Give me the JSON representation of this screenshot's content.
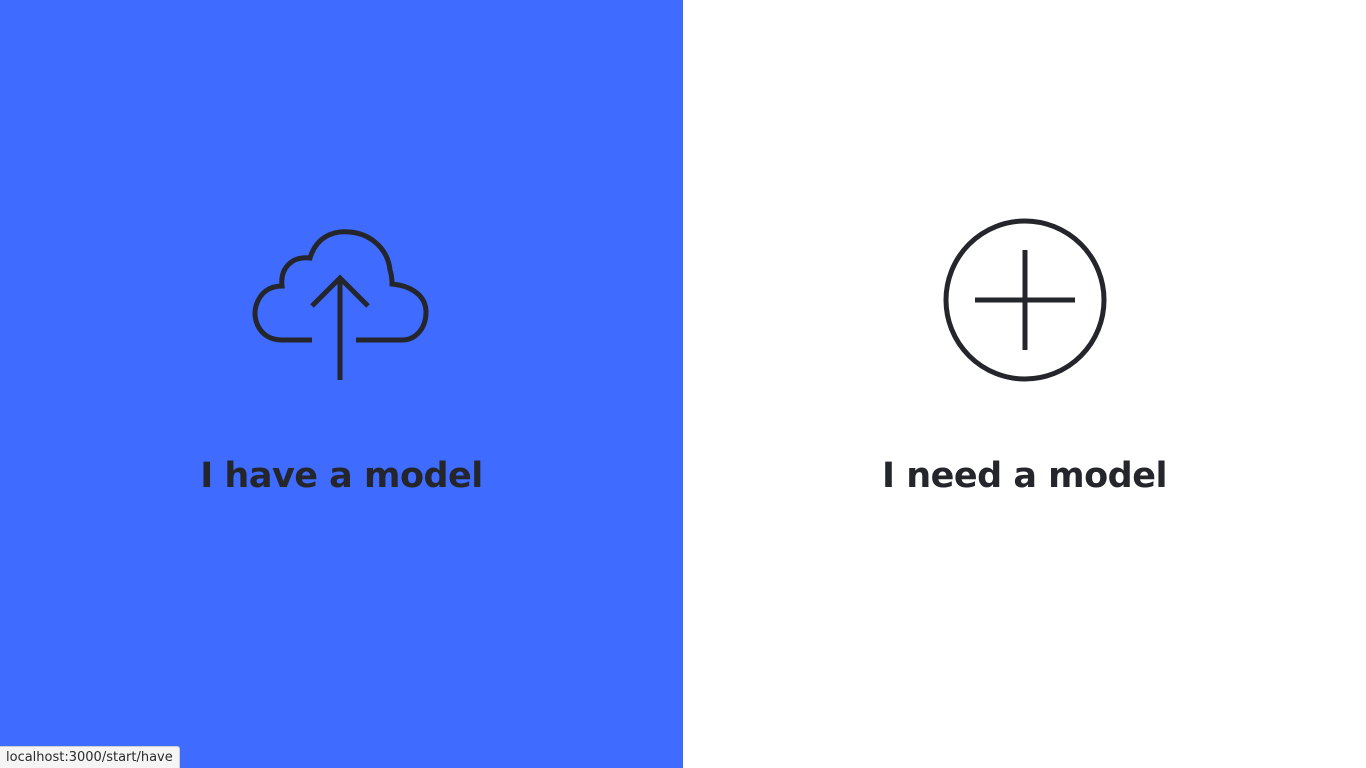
{
  "options": [
    {
      "label": "I have a model",
      "icon": "cloud-upload-icon",
      "background": "#3f6bfe"
    },
    {
      "label": "I need a model",
      "icon": "plus-circle-icon",
      "background": "#ffffff"
    }
  ],
  "status_bar": {
    "url": "localhost:3000/start/have"
  },
  "colors": {
    "accent": "#3f6bfe",
    "text": "#24262b"
  }
}
